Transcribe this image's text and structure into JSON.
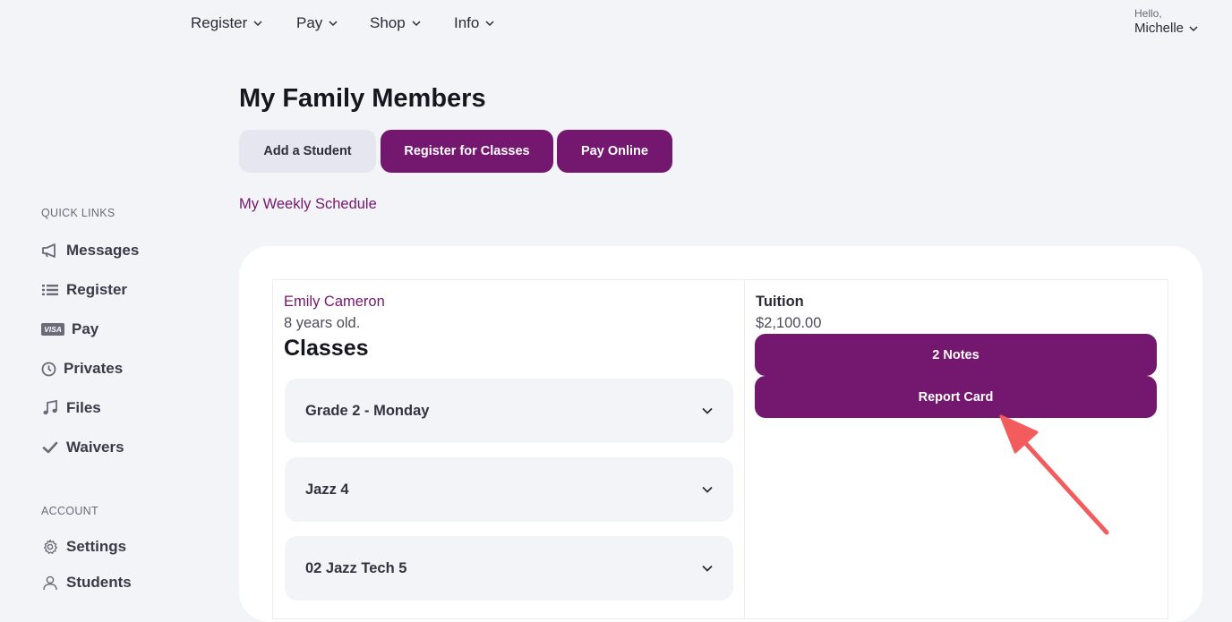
{
  "nav": {
    "items": [
      {
        "label": "Register"
      },
      {
        "label": "Pay"
      },
      {
        "label": "Shop"
      },
      {
        "label": "Info"
      }
    ],
    "user": {
      "greeting": "Hello,",
      "name": "Michelle"
    }
  },
  "sidebar": {
    "quick_links_heading": "QUICK LINKS",
    "quick_links": [
      {
        "label": "Messages",
        "icon": "megaphone-icon"
      },
      {
        "label": "Register",
        "icon": "list-icon"
      },
      {
        "label": "Pay",
        "icon": "visa-card-icon",
        "icon_text": "VISA"
      },
      {
        "label": "Privates",
        "icon": "clock-icon"
      },
      {
        "label": "Files",
        "icon": "music-note-icon"
      },
      {
        "label": "Waivers",
        "icon": "checkmark-icon"
      }
    ],
    "account_heading": "ACCOUNT",
    "account_links": [
      {
        "label": "Settings",
        "icon": "gear-icon"
      },
      {
        "label": "Students",
        "icon": "user-icon"
      }
    ]
  },
  "main": {
    "title": "My Family Members",
    "buttons": {
      "add_student": "Add a Student",
      "register_classes": "Register for Classes",
      "pay_online": "Pay Online"
    },
    "weekly_schedule_link": "My Weekly Schedule",
    "student": {
      "name": "Emily Cameron",
      "age": "8 years old.",
      "classes_heading": "Classes",
      "classes": [
        {
          "label": "Grade 2 - Monday"
        },
        {
          "label": "Jazz 4"
        },
        {
          "label": "02 Jazz Tech 5"
        }
      ],
      "tuition_label": "Tuition",
      "tuition_amount": "$2,100.00",
      "notes_button": "2 Notes",
      "report_card_button": "Report Card"
    }
  },
  "colors": {
    "brand_purple": "#74176e",
    "background": "#f3f4f8",
    "annotation_arrow": "#f25c5c"
  }
}
